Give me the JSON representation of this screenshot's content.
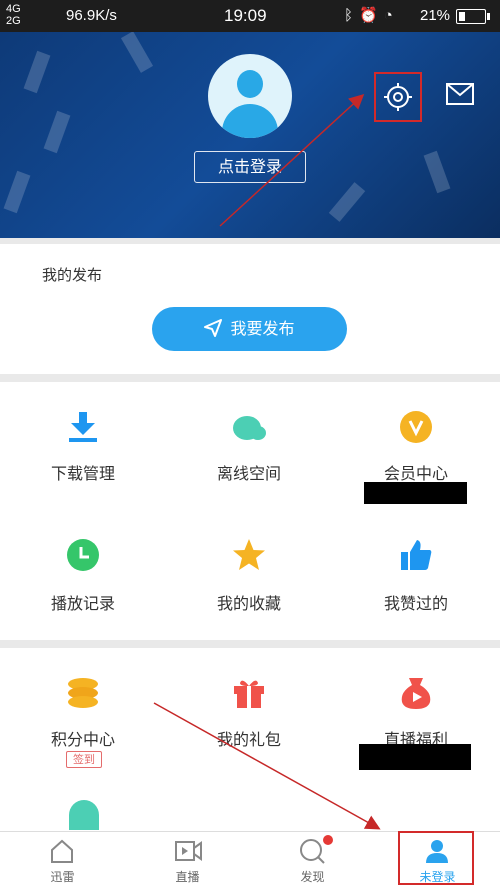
{
  "status_bar": {
    "network_top": "4G",
    "network_bottom": "2G",
    "speed": "96.9K/s",
    "time": "19:09",
    "icons": "bluetooth-icon alarm-icon wifi-icon",
    "battery": "21%"
  },
  "header": {
    "login_label": "点击登录"
  },
  "publish": {
    "title": "我的发布",
    "button_label": "我要发布"
  },
  "grid1": [
    {
      "label": "下载管理",
      "icon": "download-icon"
    },
    {
      "label": "离线空间",
      "icon": "cloud-icon"
    },
    {
      "label": "会员中心",
      "icon": "vip-icon"
    },
    {
      "label": "播放记录",
      "icon": "clock-icon"
    },
    {
      "label": "我的收藏",
      "icon": "star-icon"
    },
    {
      "label": "我赞过的",
      "icon": "thumbs-up-icon"
    }
  ],
  "grid2": [
    {
      "label": "积分中心",
      "icon": "coins-icon",
      "badge": "签到"
    },
    {
      "label": "我的礼包",
      "icon": "gift-icon"
    },
    {
      "label": "直播福利",
      "icon": "live-bag-icon"
    }
  ],
  "tabs": [
    {
      "label": "迅雷",
      "icon": "home-icon"
    },
    {
      "label": "直播",
      "icon": "video-icon"
    },
    {
      "label": "发现",
      "icon": "discover-icon"
    },
    {
      "label": "未登录",
      "icon": "profile-icon"
    }
  ],
  "colors": {
    "accent": "#2aa3ee",
    "header_bg": "#134c98",
    "annotation_red": "#d32a2a"
  }
}
